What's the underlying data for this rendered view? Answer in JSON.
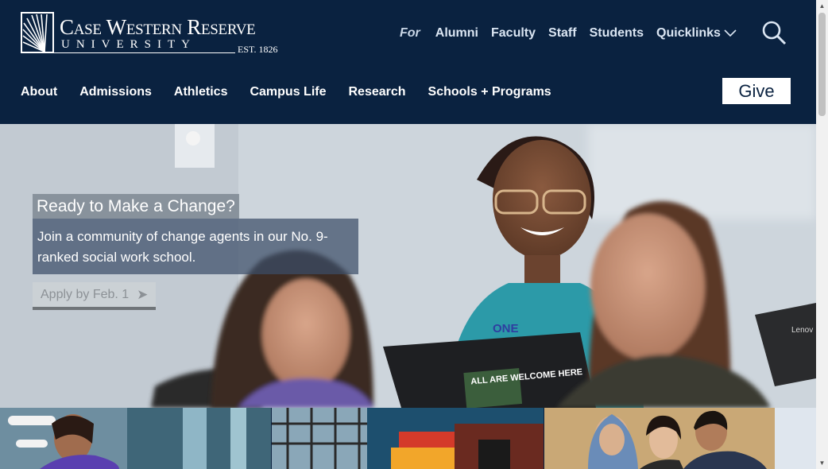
{
  "brand": {
    "line1": "Case Western Reserve",
    "line2": "UNIVERSITY",
    "est": "EST. 1826",
    "navy": "#0a2240"
  },
  "audience_nav": {
    "prefix": "For",
    "items": [
      "Alumni",
      "Faculty",
      "Staff",
      "Students"
    ],
    "quicklinks": "Quicklinks"
  },
  "main_nav": {
    "items": [
      "About",
      "Admissions",
      "Athletics",
      "Campus Life",
      "Research",
      "Schools + Programs"
    ]
  },
  "give_button": "Give",
  "hero": {
    "title": "Ready to Make a Change?",
    "text": "Join a community of change agents in our No. 9-ranked social work school.",
    "cta": "Apply by Feb. 1",
    "cta_arrow": "➤",
    "laptop_sticker": "ALL ARE WELCOME HERE",
    "laptop_brand": "Lenov",
    "shirt_text": "ONE"
  },
  "icons": {
    "search": "search-icon",
    "chevron": "chevron-down-icon",
    "logo": "sunburst-logo-icon"
  },
  "scrollbar": {
    "up": "▲",
    "down": "▼"
  }
}
